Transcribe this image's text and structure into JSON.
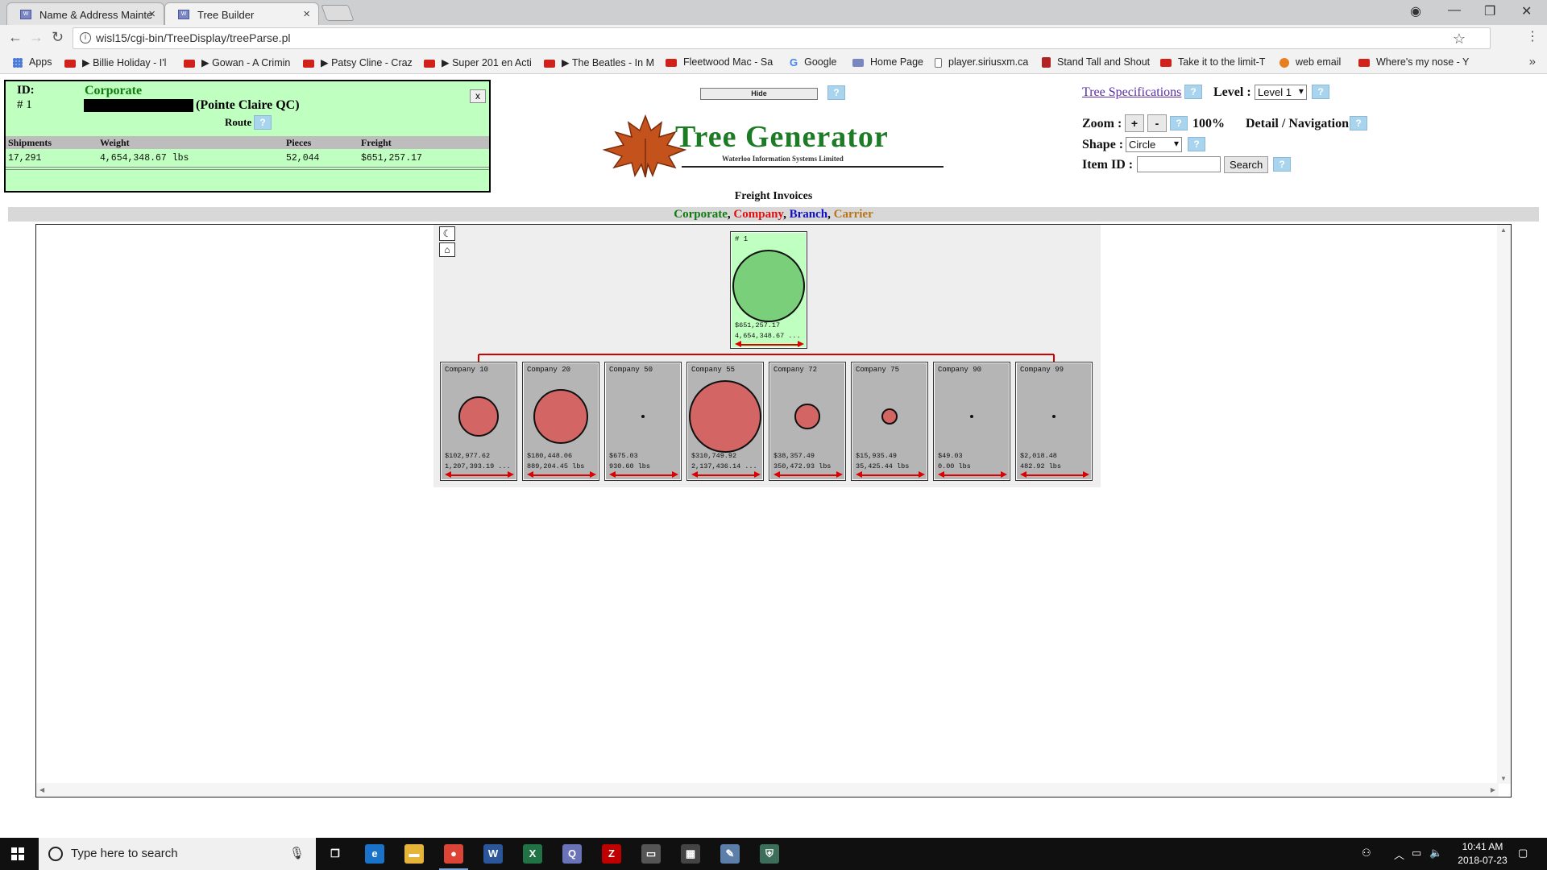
{
  "browser": {
    "tabs": [
      {
        "title": "Name & Address Mainte",
        "active": false
      },
      {
        "title": "Tree Builder",
        "active": true
      }
    ],
    "url": "wisl15/cgi-bin/TreeDisplay/treeParse.pl",
    "bookmarks": [
      {
        "label": "Apps",
        "icon": "apps-icon"
      },
      {
        "label": "▶ Billie Holiday - I'l",
        "icon": "youtube-icon"
      },
      {
        "label": "▶ Gowan - A Crimin",
        "icon": "youtube-icon"
      },
      {
        "label": "▶ Patsy Cline - Craz",
        "icon": "youtube-icon"
      },
      {
        "label": "▶ Super 201 en Acti",
        "icon": "youtube-icon"
      },
      {
        "label": "▶ The Beatles - In M",
        "icon": "youtube-icon"
      },
      {
        "label": "Fleetwood Mac - Sa",
        "icon": "youtube-icon"
      },
      {
        "label": "Google",
        "icon": "google-icon"
      },
      {
        "label": "Home Page",
        "icon": "wisl-icon"
      },
      {
        "label": "player.siriusxm.ca",
        "icon": "doc-icon"
      },
      {
        "label": "Stand Tall and Shout",
        "icon": "bookmark-red-icon"
      },
      {
        "label": "Take it to the limit-T",
        "icon": "youtube-icon"
      },
      {
        "label": "web email",
        "icon": "web-icon"
      },
      {
        "label": "Where's my nose - Y",
        "icon": "youtube-icon"
      }
    ]
  },
  "info_panel": {
    "id_label": "ID:",
    "id_value": "# 1",
    "level_name": "Corporate",
    "location": "(Pointe Claire QC)",
    "route_label": "Route",
    "close_label": "x",
    "headers": [
      "Shipments",
      "Weight",
      "Pieces",
      "Freight"
    ],
    "values": [
      "17,291",
      "4,654,348.67 lbs",
      "52,044",
      "$651,257.17"
    ]
  },
  "hide_label": "Hide",
  "help_label": "?",
  "logo": {
    "title": "Tree Generator",
    "subtitle": "Waterloo Information Systems Limited"
  },
  "controls": {
    "tree_spec_link": "Tree Specifications",
    "level_label": "Level :",
    "level_value": "Level 1",
    "zoom_label": "Zoom :",
    "zoom_in": "+",
    "zoom_out": "-",
    "zoom_value": "100%",
    "detail_nav": "Detail / Navigation",
    "shape_label": "Shape :",
    "shape_value": "Circle",
    "item_id_label": "Item ID :",
    "item_id_value": "",
    "search_label": "Search"
  },
  "report_title": "Freight Invoices",
  "legend": [
    {
      "label": "Corporate",
      "color": "#117a11"
    },
    {
      "label": "Company",
      "color": "#e01010"
    },
    {
      "label": "Branch",
      "color": "#1010c8"
    },
    {
      "label": "Carrier",
      "color": "#b8741a"
    }
  ],
  "legend_sep": ",",
  "tree": {
    "root": {
      "label": "# 1",
      "freight": "$651,257.17",
      "weight": "4,654,348.67 ...",
      "fill": "#7acf7a",
      "node_bg": "#bfffbf"
    },
    "children": [
      {
        "label": "Company 10",
        "freight": "$102,977.62",
        "weight": "1,207,393.19 ...",
        "size": 0.56
      },
      {
        "label": "Company 20",
        "freight": "$180,448.06",
        "weight": "889,204.45 lbs",
        "size": 0.76
      },
      {
        "label": "Company 50",
        "freight": "$675.03",
        "weight": "930.60 lbs",
        "size": 0.04
      },
      {
        "label": "Company 55",
        "freight": "$310,749.92",
        "weight": "2,137,436.14 ...",
        "size": 1.0
      },
      {
        "label": "Company 72",
        "freight": "$38,357.49",
        "weight": "350,472.93 lbs",
        "size": 0.35
      },
      {
        "label": "Company 75",
        "freight": "$15,935.49",
        "weight": "35,425.44 lbs",
        "size": 0.22
      },
      {
        "label": "Company 90",
        "freight": "$49.03",
        "weight": "0.00 lbs",
        "size": 0.04
      },
      {
        "label": "Company 99",
        "freight": "$2,018.48",
        "weight": "482.92 lbs",
        "size": 0.04
      }
    ],
    "child_fill": "#d46565",
    "child_bg": "#b5b5b5",
    "connector_color": "#d00000"
  },
  "taskbar": {
    "search_placeholder": "Type here to search",
    "time": "10:41 AM",
    "date": "2018-07-23",
    "apps": [
      {
        "name": "task-view-icon",
        "glyph": "❐",
        "color": "#101010"
      },
      {
        "name": "edge-icon",
        "glyph": "e",
        "color": "#1a73c9"
      },
      {
        "name": "file-explorer-icon",
        "glyph": "▬",
        "color": "#e7b43a"
      },
      {
        "name": "chrome-icon",
        "glyph": "●",
        "color": "#db4437"
      },
      {
        "name": "word-icon",
        "glyph": "W",
        "color": "#2b579a"
      },
      {
        "name": "excel-icon",
        "glyph": "X",
        "color": "#217346"
      },
      {
        "name": "wisl-app-icon",
        "glyph": "Q",
        "color": "#6a72b8"
      },
      {
        "name": "filezilla-icon",
        "glyph": "Z",
        "color": "#bf0000"
      },
      {
        "name": "window-app-icon",
        "glyph": "▭",
        "color": "#555555"
      },
      {
        "name": "calculator-icon",
        "glyph": "▦",
        "color": "#444444"
      },
      {
        "name": "pencil-app-icon",
        "glyph": "✎",
        "color": "#5b7fa8"
      },
      {
        "name": "shield-app-icon",
        "glyph": "⛨",
        "color": "#3d6e5a"
      }
    ]
  }
}
